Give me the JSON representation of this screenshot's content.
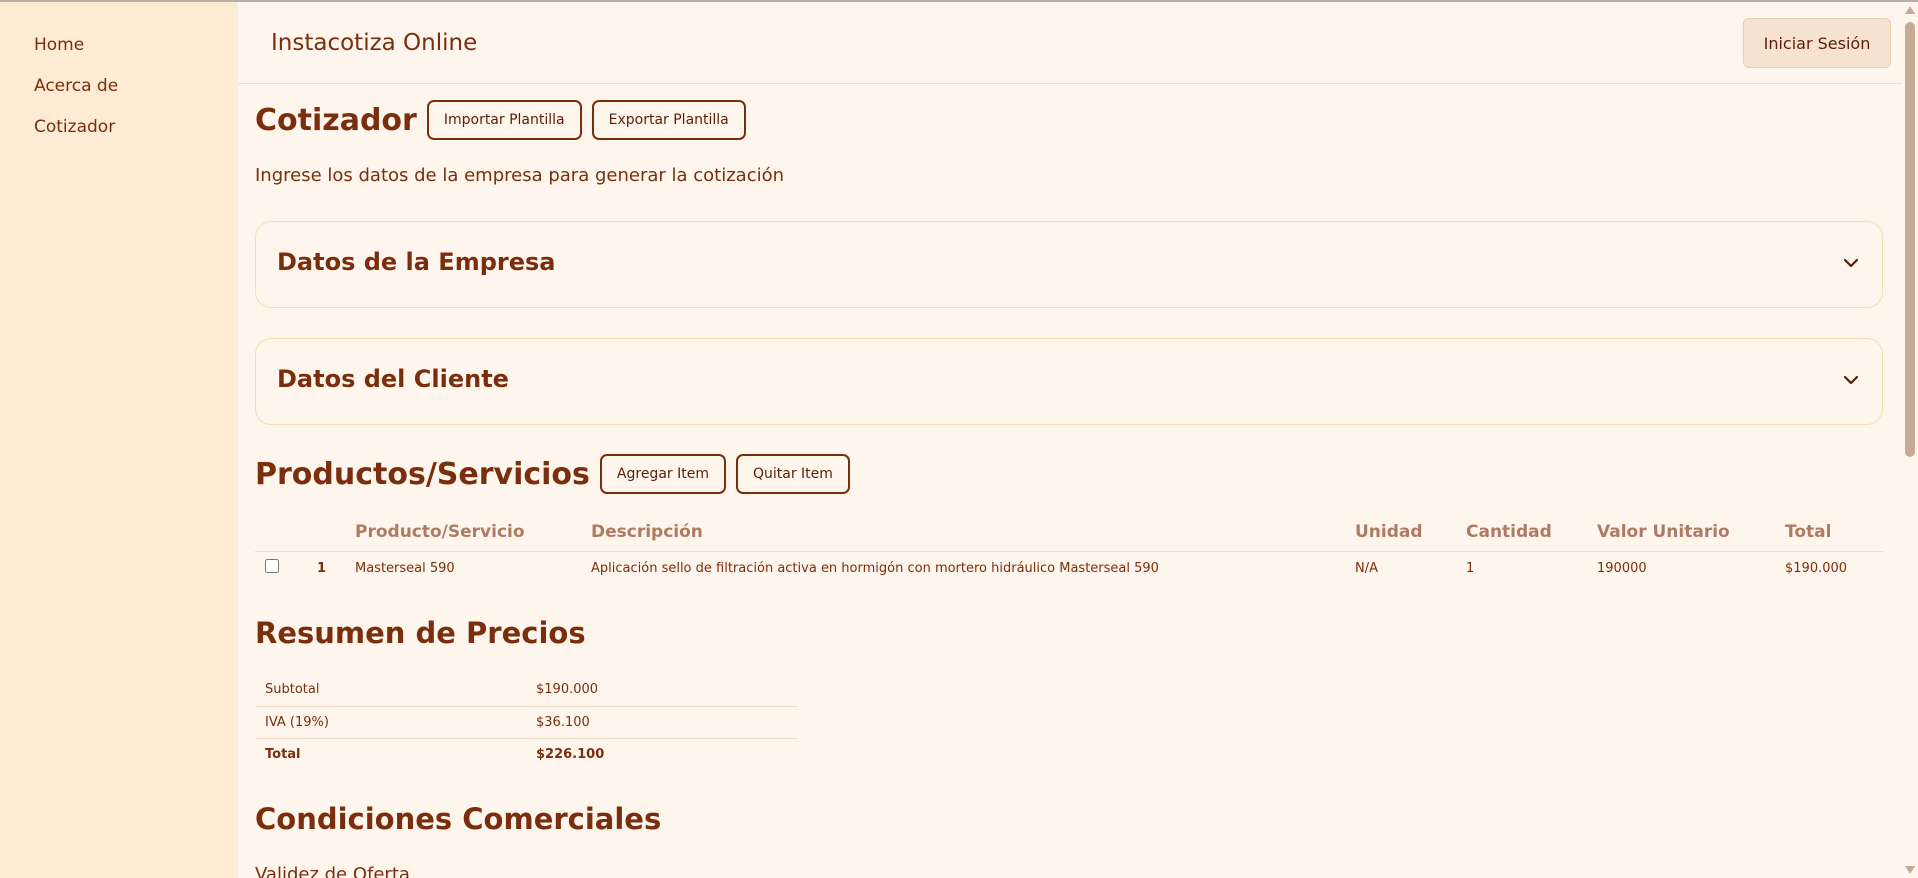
{
  "sidebar": {
    "items": [
      {
        "label": "Home"
      },
      {
        "label": "Acerca de"
      },
      {
        "label": "Cotizador"
      }
    ]
  },
  "header": {
    "title": "Instacotiza Online",
    "login_label": "Iniciar Sesión"
  },
  "cotizador": {
    "title": "Cotizador",
    "import_label": "Importar Plantilla",
    "export_label": "Exportar Plantilla",
    "subtitle": "Ingrese los datos de la empresa para generar la cotización"
  },
  "sections": {
    "empresa": "Datos de la Empresa",
    "cliente": "Datos del Cliente"
  },
  "productos": {
    "title": "Productos/Servicios",
    "add_label": "Agregar Item",
    "remove_label": "Quitar Item",
    "columns": [
      "Producto/Servicio",
      "Descripción",
      "Unidad",
      "Cantidad",
      "Valor Unitario",
      "Total"
    ],
    "rows": [
      {
        "num": "1",
        "producto": "Masterseal 590",
        "descripcion": "Aplicación sello de filtración activa en hormigón con mortero hidráulico Masterseal 590",
        "unidad": "N/A",
        "cantidad": "1",
        "valor_unitario": "190000",
        "total": "$190.000"
      }
    ]
  },
  "resumen": {
    "title": "Resumen de Precios",
    "rows": [
      {
        "label": "Subtotal",
        "value": "$190.000"
      },
      {
        "label": "IVA (19%)",
        "value": "$36.100"
      },
      {
        "label": "Total",
        "value": "$226.100"
      }
    ]
  },
  "condiciones": {
    "title": "Condiciones Comerciales",
    "validez_label": "Validez de Oferta"
  }
}
